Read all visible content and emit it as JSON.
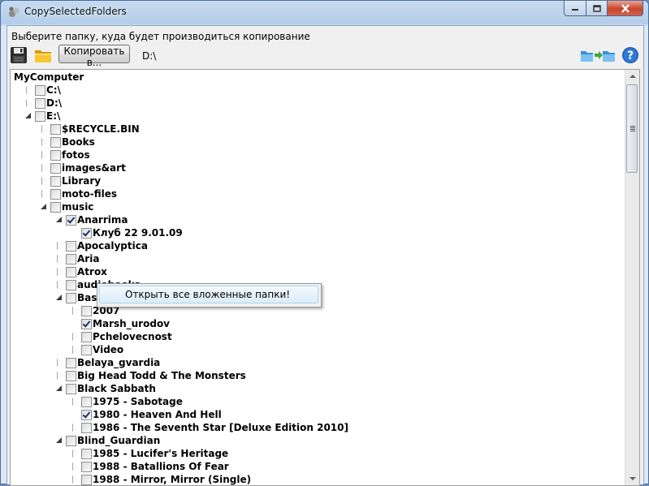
{
  "window": {
    "title": "CopySelectedFolders",
    "buttons": [
      "minimize",
      "maximize",
      "close"
    ]
  },
  "toolbar": {
    "prompt": "Выберите папку, куда будет производиться копирование",
    "copy_button_label": "Копировать в...",
    "destination_path": "D:\\",
    "icons": [
      "save-icon",
      "open-folder-icon",
      "transfer-icon",
      "help-icon"
    ]
  },
  "tree": {
    "nodes": [
      {
        "label": "MyComputer",
        "checkbox": false,
        "expander": "none",
        "checked": false
      },
      {
        "label": "C:\\",
        "checkbox": true,
        "expander": "collapsed",
        "checked": false
      },
      {
        "label": "D:\\",
        "checkbox": true,
        "expander": "collapsed",
        "checked": false
      },
      {
        "label": "E:\\",
        "checkbox": true,
        "expander": "expanded",
        "checked": false
      },
      {
        "label": "$RECYCLE.BIN",
        "checkbox": true,
        "expander": "collapsed",
        "checked": false
      },
      {
        "label": "Books",
        "checkbox": true,
        "expander": "collapsed",
        "checked": false
      },
      {
        "label": "fotos",
        "checkbox": true,
        "expander": "collapsed",
        "checked": false
      },
      {
        "label": "images&art",
        "checkbox": true,
        "expander": "collapsed",
        "checked": false
      },
      {
        "label": "Library",
        "checkbox": true,
        "expander": "collapsed",
        "checked": false
      },
      {
        "label": "moto-files",
        "checkbox": true,
        "expander": "collapsed",
        "checked": false
      },
      {
        "label": "music",
        "checkbox": true,
        "expander": "expanded",
        "checked": false
      },
      {
        "label": "Anarrima",
        "checkbox": true,
        "expander": "expanded",
        "checked": true
      },
      {
        "label": "Клуб 22 9.01.09",
        "checkbox": true,
        "expander": "none",
        "checked": true
      },
      {
        "label": "Apocalyptica",
        "checkbox": true,
        "expander": "collapsed",
        "checked": false
      },
      {
        "label": "Aria",
        "checkbox": true,
        "expander": "collapsed",
        "checked": false
      },
      {
        "label": "Atrox",
        "checkbox": true,
        "expander": "collapsed",
        "checked": false
      },
      {
        "label": "audiobooks",
        "checkbox": true,
        "expander": "collapsed",
        "checked": false
      },
      {
        "label": "Bashya_Rowen",
        "checkbox": true,
        "expander": "expanded",
        "checked": false
      },
      {
        "label": "2007",
        "checkbox": true,
        "expander": "collapsed",
        "checked": false
      },
      {
        "label": "Marsh_urodov",
        "checkbox": true,
        "expander": "none",
        "checked": true
      },
      {
        "label": "Pchelovecnost",
        "checkbox": true,
        "expander": "collapsed",
        "checked": false
      },
      {
        "label": "Video",
        "checkbox": true,
        "expander": "collapsed",
        "checked": false
      },
      {
        "label": "Belaya_gvardia",
        "checkbox": true,
        "expander": "collapsed",
        "checked": false
      },
      {
        "label": "Big Head Todd & The Monsters",
        "checkbox": true,
        "expander": "collapsed",
        "checked": false
      },
      {
        "label": "Black Sabbath",
        "checkbox": true,
        "expander": "expanded",
        "checked": false
      },
      {
        "label": "1975 - Sabotage",
        "checkbox": true,
        "expander": "collapsed",
        "checked": false
      },
      {
        "label": "1980 - Heaven And Hell",
        "checkbox": true,
        "expander": "none",
        "checked": true
      },
      {
        "label": "1986 - The Seventh Star [Deluxe Edition 2010]",
        "checkbox": true,
        "expander": "collapsed",
        "checked": false
      },
      {
        "label": "Blind_Guardian",
        "checkbox": true,
        "expander": "expanded",
        "checked": false
      },
      {
        "label": "1985 - Lucifer's Heritage",
        "checkbox": true,
        "expander": "collapsed",
        "checked": false
      },
      {
        "label": "1988 - Batallions Of Fear",
        "checkbox": true,
        "expander": "collapsed",
        "checked": false
      },
      {
        "label": "1988 - Mirror, Mirror (Single)",
        "checkbox": true,
        "expander": "collapsed",
        "checked": false
      }
    ]
  },
  "context_menu": {
    "items": [
      "Открыть все вложенные папки!"
    ]
  }
}
